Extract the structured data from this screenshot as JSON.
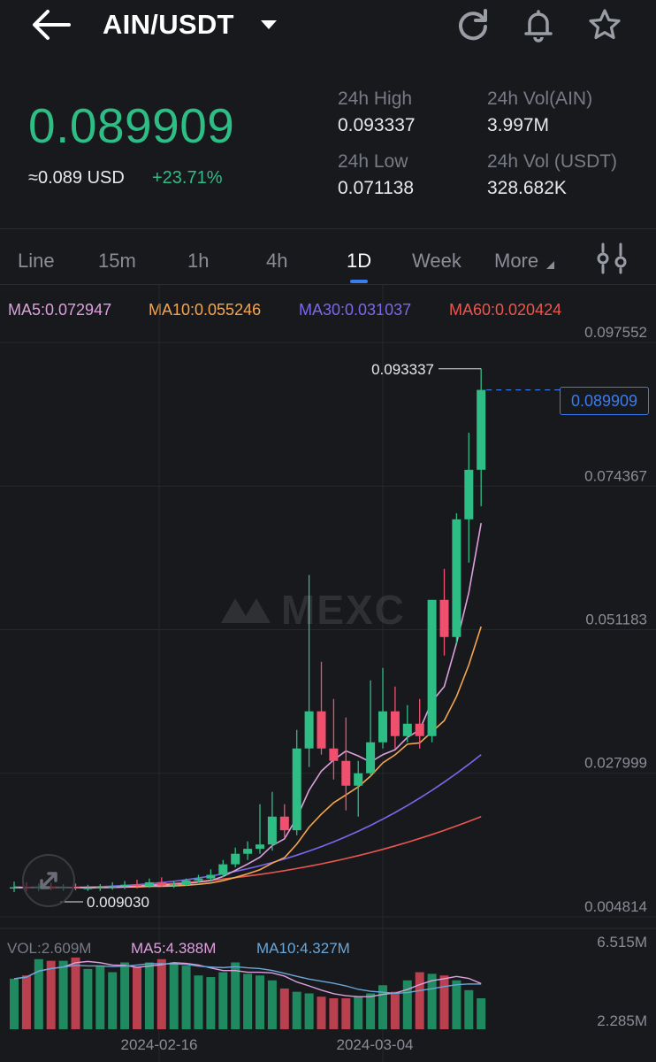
{
  "header": {
    "pair": "AIN/USDT",
    "icons": [
      "back-arrow-icon",
      "caret-down-icon",
      "refresh-icon",
      "bell-icon",
      "star-icon"
    ]
  },
  "ticker": {
    "last_price": "0.089909",
    "usd_value": "≈0.089 USD",
    "change_pct": "+23.71%",
    "stats": [
      {
        "label": "24h High",
        "value": "0.093337"
      },
      {
        "label": "24h Vol(AIN)",
        "value": "3.997M"
      },
      {
        "label": "24h Low",
        "value": "0.071138"
      },
      {
        "label": "24h Vol (USDT)",
        "value": "328.682K"
      }
    ]
  },
  "tabs": {
    "items": [
      "Line",
      "15m",
      "1h",
      "4h",
      "1D",
      "Week",
      "More"
    ],
    "active": "1D",
    "settings_icon": "chart-settings-icon"
  },
  "ma_legend": {
    "ma5": "MA5:0.072947",
    "ma10": "MA10:0.055246",
    "ma30": "MA30:0.031037",
    "ma60": "MA60:0.020424"
  },
  "vol_legend": {
    "vol": "VOL:2.609M",
    "ma5": "MA5:4.388M",
    "ma10": "MA10:4.327M"
  },
  "colors": {
    "up": "#2ebd85",
    "down": "#f0506e",
    "ma5": "#dda0dd",
    "ma10": "#f5a650",
    "ma30": "#7b68ee",
    "ma60": "#e9574f",
    "vol_ma10": "#6aa7d9",
    "accent": "#3a7bf0"
  },
  "watermark": "MEXC",
  "chart_data": {
    "type": "candlestick",
    "y_ticks": [
      "0.097552",
      "0.074367",
      "0.051183",
      "0.027999",
      "0.004814"
    ],
    "ylim": [
      0.004814,
      0.097552
    ],
    "x_ticks": [
      "2024-02-16",
      "2024-03-04"
    ],
    "high_label": "0.093337",
    "low_label": "0.009030",
    "last_price_label": "0.089909",
    "volume_ticks": [
      "6.515M",
      "2.285M"
    ],
    "candles": [
      {
        "o": 0.0094,
        "h": 0.0105,
        "l": 0.0088,
        "c": 0.0096
      },
      {
        "o": 0.0096,
        "h": 0.0104,
        "l": 0.0089,
        "c": 0.0095
      },
      {
        "o": 0.0095,
        "h": 0.0102,
        "l": 0.009,
        "c": 0.0097
      },
      {
        "o": 0.0097,
        "h": 0.0103,
        "l": 0.0091,
        "c": 0.0095
      },
      {
        "o": 0.0095,
        "h": 0.0101,
        "l": 0.009,
        "c": 0.0096
      },
      {
        "o": 0.0096,
        "h": 0.0102,
        "l": 0.0091,
        "c": 0.0094
      },
      {
        "o": 0.0094,
        "h": 0.01,
        "l": 0.009,
        "c": 0.0095
      },
      {
        "o": 0.0095,
        "h": 0.0101,
        "l": 0.009,
        "c": 0.0096
      },
      {
        "o": 0.0096,
        "h": 0.0104,
        "l": 0.0092,
        "c": 0.0098
      },
      {
        "o": 0.0098,
        "h": 0.0106,
        "l": 0.0093,
        "c": 0.01
      },
      {
        "o": 0.01,
        "h": 0.0108,
        "l": 0.0094,
        "c": 0.0098
      },
      {
        "o": 0.0098,
        "h": 0.011,
        "l": 0.0095,
        "c": 0.0104
      },
      {
        "o": 0.0104,
        "h": 0.0112,
        "l": 0.0096,
        "c": 0.0099
      },
      {
        "o": 0.0099,
        "h": 0.0106,
        "l": 0.0095,
        "c": 0.0101
      },
      {
        "o": 0.0101,
        "h": 0.011,
        "l": 0.0098,
        "c": 0.0107
      },
      {
        "o": 0.0107,
        "h": 0.0116,
        "l": 0.0103,
        "c": 0.011
      },
      {
        "o": 0.011,
        "h": 0.0125,
        "l": 0.0105,
        "c": 0.0116
      },
      {
        "o": 0.0116,
        "h": 0.014,
        "l": 0.0112,
        "c": 0.0133
      },
      {
        "o": 0.0133,
        "h": 0.016,
        "l": 0.0128,
        "c": 0.015
      },
      {
        "o": 0.015,
        "h": 0.017,
        "l": 0.014,
        "c": 0.0158
      },
      {
        "o": 0.0158,
        "h": 0.023,
        "l": 0.015,
        "c": 0.0165
      },
      {
        "o": 0.0165,
        "h": 0.025,
        "l": 0.0155,
        "c": 0.021
      },
      {
        "o": 0.021,
        "h": 0.023,
        "l": 0.0175,
        "c": 0.0188
      },
      {
        "o": 0.0188,
        "h": 0.035,
        "l": 0.018,
        "c": 0.032
      },
      {
        "o": 0.032,
        "h": 0.06,
        "l": 0.029,
        "c": 0.038
      },
      {
        "o": 0.038,
        "h": 0.046,
        "l": 0.031,
        "c": 0.032
      },
      {
        "o": 0.032,
        "h": 0.04,
        "l": 0.027,
        "c": 0.03
      },
      {
        "o": 0.03,
        "h": 0.037,
        "l": 0.022,
        "c": 0.026
      },
      {
        "o": 0.026,
        "h": 0.03,
        "l": 0.021,
        "c": 0.028
      },
      {
        "o": 0.028,
        "h": 0.043,
        "l": 0.0275,
        "c": 0.033
      },
      {
        "o": 0.033,
        "h": 0.045,
        "l": 0.032,
        "c": 0.038
      },
      {
        "o": 0.038,
        "h": 0.042,
        "l": 0.032,
        "c": 0.034
      },
      {
        "o": 0.034,
        "h": 0.039,
        "l": 0.033,
        "c": 0.036
      },
      {
        "o": 0.036,
        "h": 0.04,
        "l": 0.032,
        "c": 0.034
      },
      {
        "o": 0.034,
        "h": 0.05,
        "l": 0.033,
        "c": 0.056
      },
      {
        "o": 0.056,
        "h": 0.061,
        "l": 0.047,
        "c": 0.05
      },
      {
        "o": 0.05,
        "h": 0.07,
        "l": 0.049,
        "c": 0.069
      },
      {
        "o": 0.069,
        "h": 0.083,
        "l": 0.062,
        "c": 0.077
      },
      {
        "o": 0.077,
        "h": 0.0933,
        "l": 0.0711,
        "c": 0.0899
      }
    ],
    "volume": [
      3.1,
      3.3,
      4.3,
      4.2,
      4.2,
      4.4,
      3.7,
      3.9,
      3.5,
      4.1,
      3.8,
      4.1,
      4.3,
      4.1,
      3.9,
      3.3,
      3.2,
      3.5,
      4.1,
      3.4,
      3.3,
      3.0,
      2.5,
      2.3,
      2.2,
      2.0,
      1.9,
      1.9,
      2.0,
      2.2,
      2.7,
      2.3,
      3.0,
      3.5,
      3.4,
      3.3,
      3.0,
      2.4,
      1.9
    ]
  }
}
